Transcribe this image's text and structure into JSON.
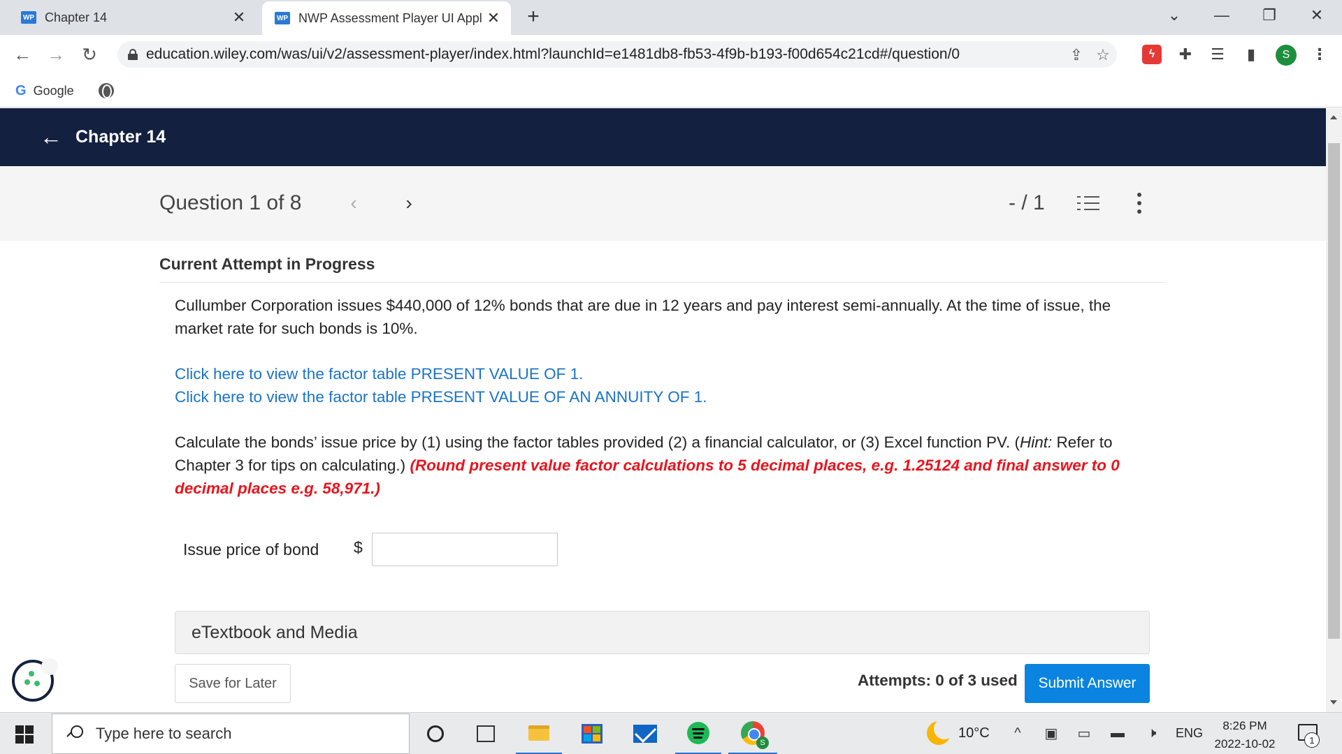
{
  "browser": {
    "tabs": [
      {
        "badge": "WP",
        "title": "Chapter 14",
        "close": "✕"
      },
      {
        "badge": "WP",
        "title": "NWP Assessment Player UI Appli",
        "close": "✕"
      }
    ],
    "new_tab": "+",
    "window_controls": {
      "dropdown": "⌄",
      "minimize": "—",
      "restore": "❐",
      "close": "✕"
    },
    "url": "education.wiley.com/was/ui/v2/assessment-player/index.html?launchId=e1481db8-fb53-4f9b-b193-f00d654c21cd#/question/0",
    "profile_initial": "S",
    "bookmarks": [
      {
        "label": "Google"
      }
    ]
  },
  "header": {
    "back_icon": "←",
    "title": "Chapter 14"
  },
  "question_bar": {
    "counter": "Question 1 of 8",
    "prev": "‹",
    "next": "›",
    "score": "- / 1"
  },
  "question": {
    "status": "Current Attempt in Progress",
    "text": "Cullumber Corporation issues $440,000 of 12% bonds that are due in 12 years and pay interest semi-annually. At the time of issue, the market rate for such bonds is 10%.",
    "links": [
      "Click here to view the factor table PRESENT VALUE OF 1.",
      "Click here to view the factor table PRESENT VALUE OF AN ANNUITY OF 1."
    ],
    "instruction_pre": "Calculate the bonds’ issue price by (1) using the factor tables provided (2) a financial calculator, or (3) Excel function PV. (",
    "instruction_hint": "Hint:",
    "instruction_post": " Refer to Chapter 3 for tips on calculating.) ",
    "instruction_red": "(Round present value factor calculations to 5 decimal places, e.g. 1.25124 and final answer to 0 decimal places e.g. 58,971.)",
    "answer_label": "Issue price of bond",
    "currency": "$",
    "answer_value": "",
    "etextbook": "eTextbook and Media",
    "save_label": "Save for Later",
    "attempts": "Attempts: 0 of 3 used",
    "submit_label": "Submit Answer"
  },
  "taskbar": {
    "search_placeholder": "Type here to search",
    "temperature": "10°C",
    "language": "ENG",
    "time": "8:26 PM",
    "date": "2022-10-02",
    "notification_count": "1"
  }
}
